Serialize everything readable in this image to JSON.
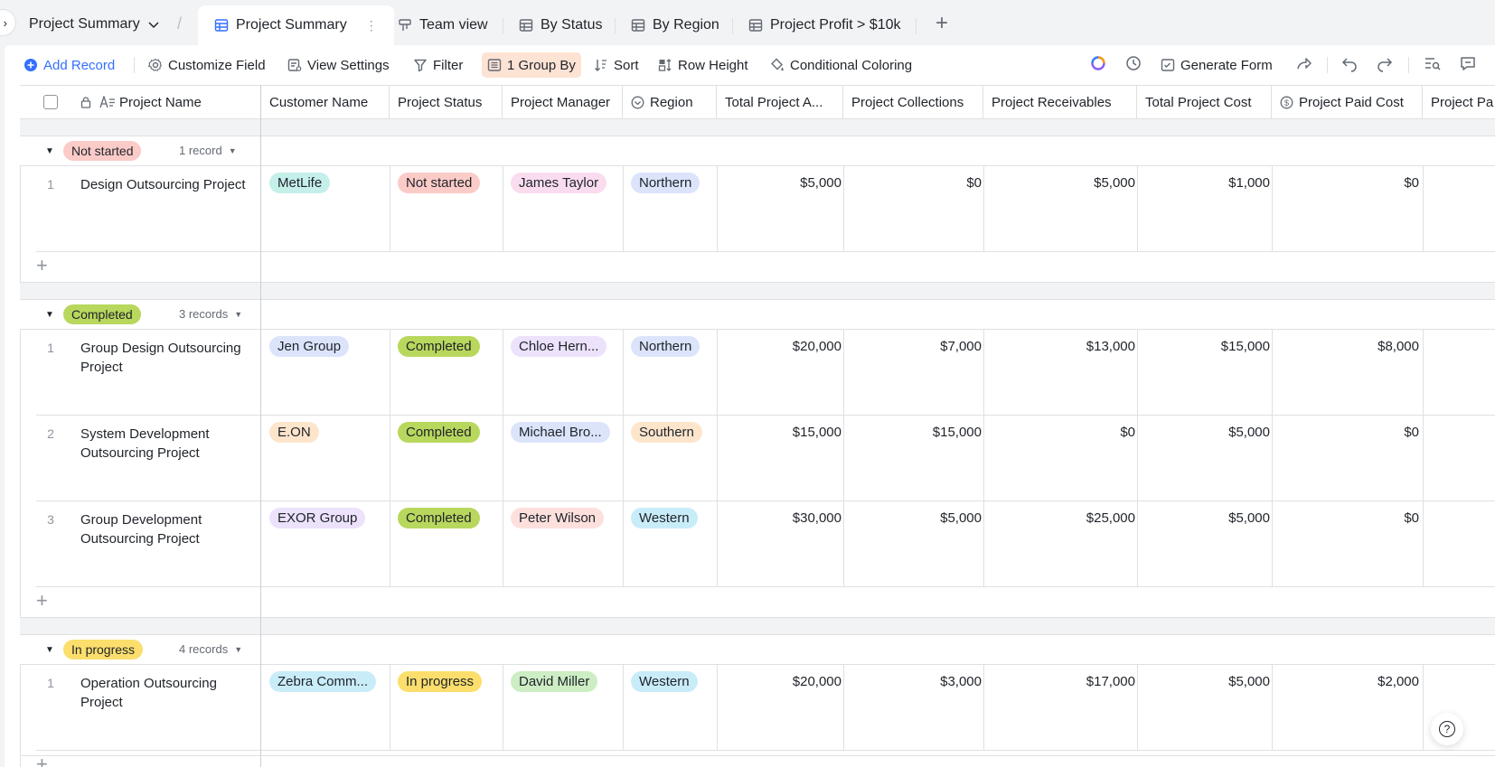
{
  "app": {
    "base_title": "Project Summary"
  },
  "tabs": [
    {
      "label": "Project Summary",
      "icon": "grid-table-icon",
      "active": true
    },
    {
      "label": "Team view",
      "icon": "kanban-icon"
    },
    {
      "label": "By Status",
      "icon": "grid-table-icon"
    },
    {
      "label": "By Region",
      "icon": "grid-table-icon"
    },
    {
      "label": "Project Profit > $10k",
      "icon": "grid-table-icon"
    }
  ],
  "toolbar": {
    "add_record": "Add Record",
    "customize_field": "Customize Field",
    "view_settings": "View Settings",
    "filter": "Filter",
    "group_by": "1 Group By",
    "sort": "Sort",
    "row_height": "Row Height",
    "conditional_coloring": "Conditional Coloring",
    "generate_form": "Generate Form"
  },
  "columns": {
    "project_name": "Project Name",
    "customer_name": "Customer Name",
    "project_status": "Project Status",
    "project_manager": "Project Manager",
    "region": "Region",
    "total_amount": "Total Project A...",
    "collections": "Project Collections",
    "receivables": "Project Receivables",
    "total_cost": "Total Project Cost",
    "paid_cost": "Project Paid Cost",
    "project_pa": "Project Pa"
  },
  "groups": [
    {
      "label": "Not started",
      "count": "1 record",
      "color": "#fbcbc8",
      "rows": [
        {
          "num": "1",
          "name": "Design Outsourcing Project",
          "customer": "MetLife",
          "customer_color": "#c5efe9",
          "status": "Not started",
          "status_color": "#fbcbc8",
          "manager": "James Taylor",
          "manager_color": "#fadcef",
          "region": "Northern",
          "region_color": "#dbe4fb",
          "total": "$5,000",
          "collections": "$0",
          "receivables": "$5,000",
          "cost": "$1,000",
          "paid": "$0"
        }
      ]
    },
    {
      "label": "Completed",
      "count": "3 records",
      "color": "#b8d75d",
      "rows": [
        {
          "num": "1",
          "name": "Group Design Outsourcing Project",
          "customer": "Jen Group",
          "customer_color": "#dbe4fb",
          "status": "Completed",
          "status_color": "#b8d75d",
          "manager": "Chloe Hern...",
          "manager_color": "#ece2fb",
          "region": "Northern",
          "region_color": "#dbe4fb",
          "total": "$20,000",
          "collections": "$7,000",
          "receivables": "$13,000",
          "cost": "$15,000",
          "paid": "$8,000"
        },
        {
          "num": "2",
          "name": "System Development Outsourcing Project",
          "customer": "E.ON",
          "customer_color": "#fde5cc",
          "status": "Completed",
          "status_color": "#b8d75d",
          "manager": "Michael Bro...",
          "manager_color": "#dbe4fb",
          "region": "Southern",
          "region_color": "#fde5cc",
          "total": "$15,000",
          "collections": "$15,000",
          "receivables": "$0",
          "cost": "$5,000",
          "paid": "$0"
        },
        {
          "num": "3",
          "name": "Group Development Outsourcing Project",
          "customer": "EXOR Group",
          "customer_color": "#ece2fb",
          "status": "Completed",
          "status_color": "#b8d75d",
          "manager": "Peter Wilson",
          "manager_color": "#fde0dc",
          "region": "Western",
          "region_color": "#c9ecf9",
          "total": "$30,000",
          "collections": "$5,000",
          "receivables": "$25,000",
          "cost": "$5,000",
          "paid": "$0"
        }
      ]
    },
    {
      "label": "In progress",
      "count": "4 records",
      "color": "#fbde6c",
      "rows": [
        {
          "num": "1",
          "name": "Operation Outsourcing Project",
          "customer": "Zebra Comm...",
          "customer_color": "#c9ecf9",
          "status": "In progress",
          "status_color": "#fbde6c",
          "manager": "David Miller",
          "manager_color": "#cdedc4",
          "region": "Western",
          "region_color": "#c9ecf9",
          "total": "$20,000",
          "collections": "$3,000",
          "receivables": "$17,000",
          "cost": "$5,000",
          "paid": "$2,000"
        }
      ]
    }
  ],
  "help": "?"
}
